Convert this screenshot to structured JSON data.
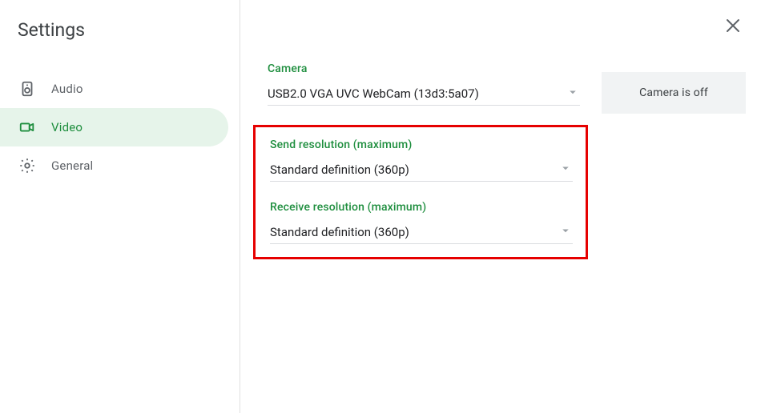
{
  "title": "Settings",
  "sidebar": {
    "items": [
      {
        "label": "Audio",
        "icon": "speaker-icon",
        "active": false
      },
      {
        "label": "Video",
        "icon": "video-icon",
        "active": true
      },
      {
        "label": "General",
        "icon": "gear-icon",
        "active": false
      }
    ]
  },
  "camera_section": {
    "label": "Camera",
    "value": "USB2.0 VGA UVC WebCam (13d3:5a07)"
  },
  "send_resolution": {
    "label": "Send resolution (maximum)",
    "value": "Standard definition (360p)"
  },
  "receive_resolution": {
    "label": "Receive resolution (maximum)",
    "value": "Standard definition (360p)"
  },
  "camera_preview_text": "Camera is off"
}
